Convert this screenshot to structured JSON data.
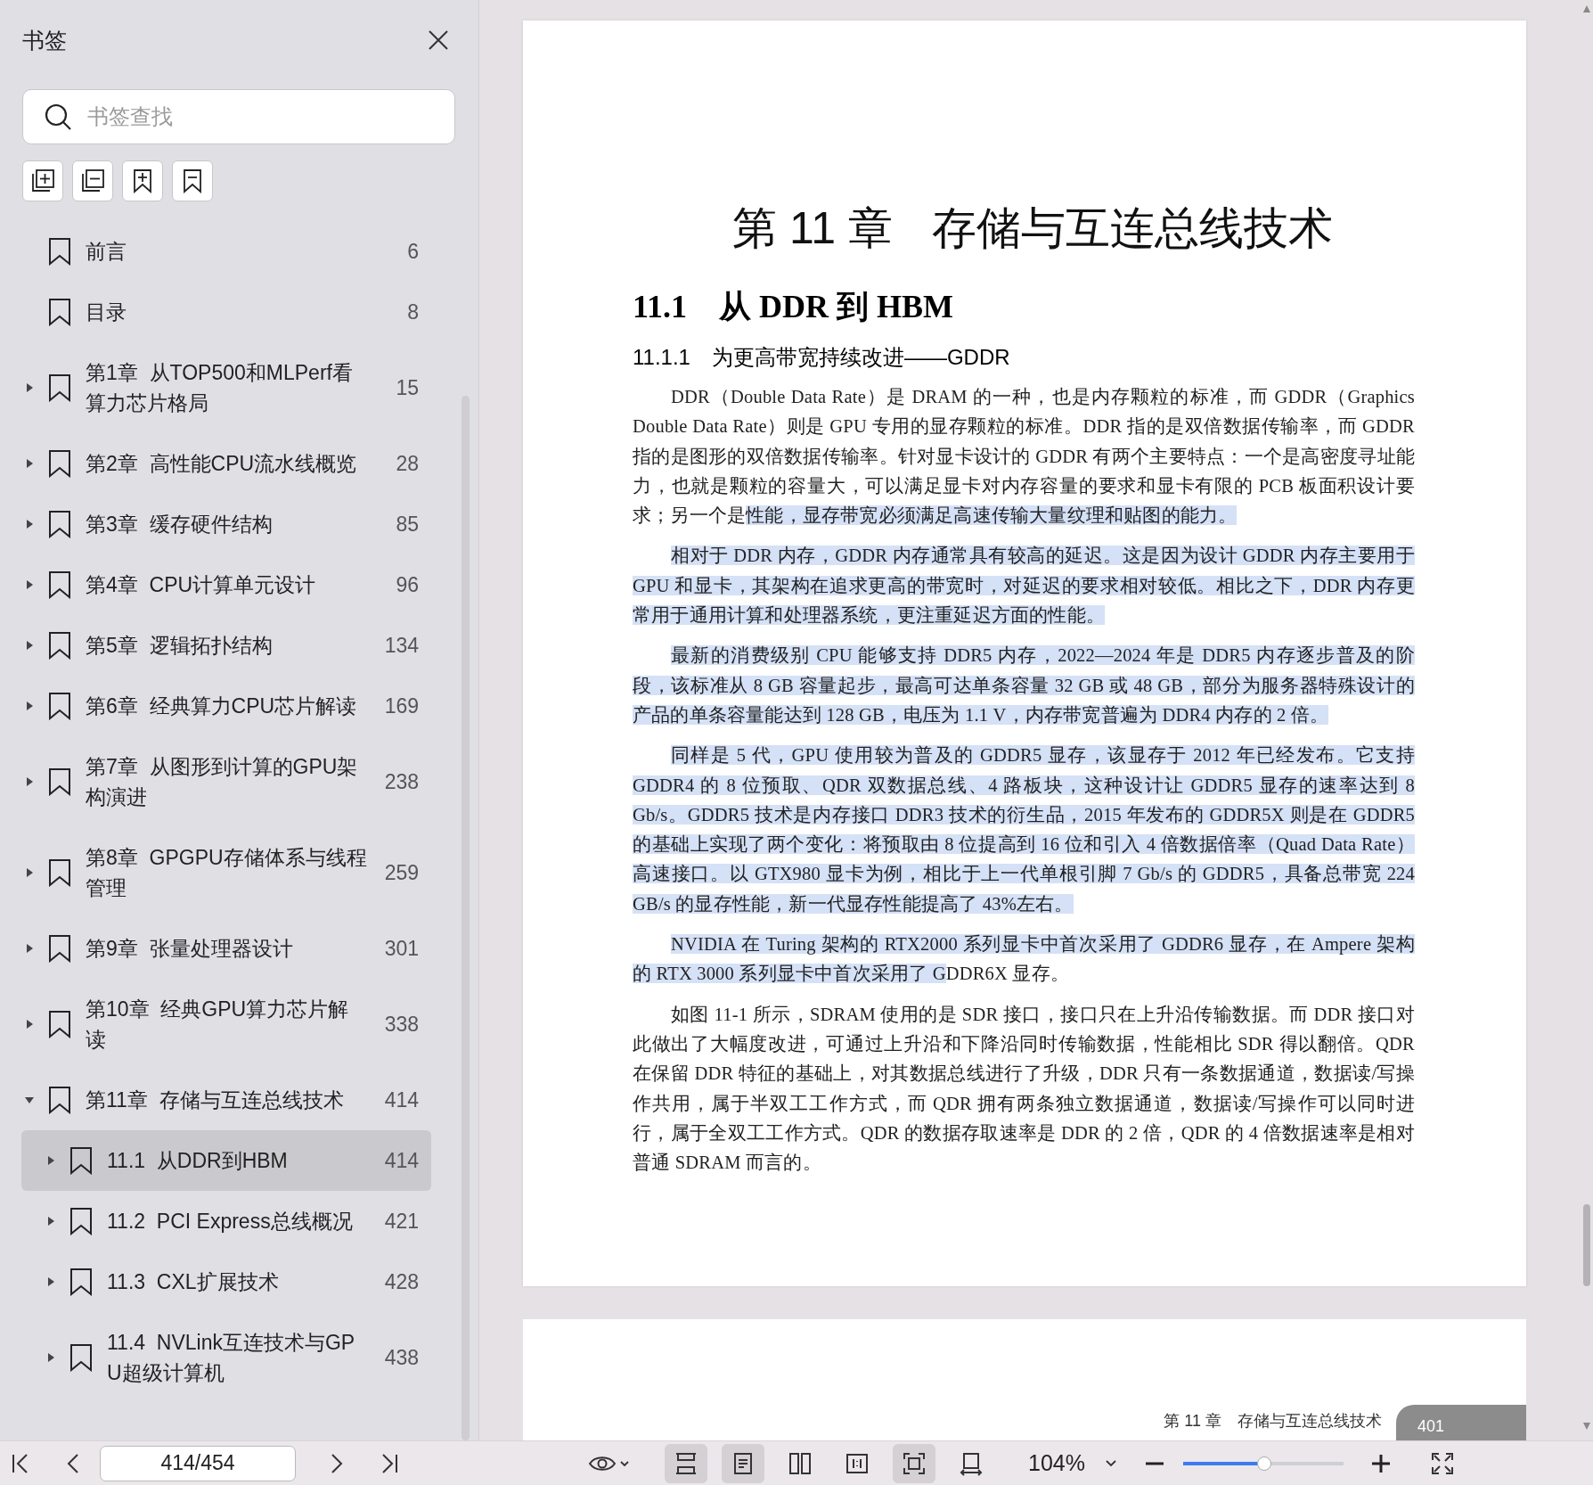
{
  "sidebar": {
    "title": "书签",
    "search": {
      "placeholder": "书签查找"
    },
    "tools": [
      {
        "kind": "expand-all"
      },
      {
        "kind": "collapse-all"
      },
      {
        "kind": "add"
      },
      {
        "kind": "remove"
      }
    ],
    "items": [
      {
        "label": "前言",
        "page": "6",
        "expandable": false,
        "selected": false
      },
      {
        "label": "目录",
        "page": "8",
        "expandable": false,
        "selected": false
      },
      {
        "label": "第1章  从TOP500和MLPerf看算力芯片格局",
        "page": "15",
        "expandable": true,
        "expanded": false,
        "selected": false
      },
      {
        "label": "第2章  高性能CPU流水线概览",
        "page": "28",
        "expandable": true,
        "expanded": false,
        "selected": false
      },
      {
        "label": "第3章  缓存硬件结构",
        "page": "85",
        "expandable": true,
        "expanded": false,
        "selected": false
      },
      {
        "label": "第4章  CPU计算单元设计",
        "page": "96",
        "expandable": true,
        "expanded": false,
        "selected": false
      },
      {
        "label": "第5章  逻辑拓扑结构",
        "page": "134",
        "expandable": true,
        "expanded": false,
        "selected": false
      },
      {
        "label": "第6章  经典算力CPU芯片解读",
        "page": "169",
        "expandable": true,
        "expanded": false,
        "selected": false
      },
      {
        "label": "第7章  从图形到计算的GPU架构演进",
        "page": "238",
        "expandable": true,
        "expanded": false,
        "selected": false
      },
      {
        "label": "第8章  GPGPU存储体系与线程管理",
        "page": "259",
        "expandable": true,
        "expanded": false,
        "selected": false
      },
      {
        "label": "第9章  张量处理器设计",
        "page": "301",
        "expandable": true,
        "expanded": false,
        "selected": false
      },
      {
        "label": "第10章  经典GPU算力芯片解读",
        "page": "338",
        "expandable": true,
        "expanded": false,
        "selected": false
      },
      {
        "label": "第11章  存储与互连总线技术",
        "page": "414",
        "expandable": true,
        "expanded": true,
        "selected": false,
        "children": [
          {
            "label": "11.1  从DDR到HBM",
            "page": "414",
            "expandable": true,
            "expanded": false,
            "selected": true
          },
          {
            "label": "11.2  PCI Express总线概况",
            "page": "421",
            "expandable": true,
            "expanded": false,
            "selected": false
          },
          {
            "label": "11.3  CXL扩展技术",
            "page": "428",
            "expandable": true,
            "expanded": false,
            "selected": false
          },
          {
            "label": "11.4  NVLink互连技术与GPU超级计算机",
            "page": "438",
            "expandable": true,
            "expanded": false,
            "selected": false
          }
        ]
      }
    ]
  },
  "page": {
    "chapter_number": "第 11 章",
    "chapter_title": "存储与互连总线技术",
    "section": "11.1　从 DDR 到 HBM",
    "subsection": "11.1.1　为更高带宽持续改进——GDDR",
    "paragraphs": [
      [
        {
          "text": "DDR（Double Data Rate）是 DRAM 的一种，也是内存颗粒的标准，而 GDDR（Graphics Double Data Rate）则是 GPU 专用的显存颗粒的标准。DDR 指的是双倍数据传输率，而 GDDR 指的是图形的双倍数据传输率。针对显卡设计的 GDDR 有两个主要特点：一个是高密度寻址能力，也就是颗粒的容量大，可以满足显卡对内存容量的要求和显卡有限的 PCB 板面积设计要求；另一个是",
          "highlighted": false
        },
        {
          "text": "性能，显存带宽必须满足高速传输大量纹理和贴图的能力。",
          "highlighted": true
        }
      ],
      [
        {
          "text": "相对于 DDR 内存，GDDR 内存通常具有较高的延迟。这是因为设计 GDDR 内存主要用于 GPU 和显卡，其架构在追求更高的带宽时，对延迟的要求相对较低。相比之下，DDR 内存更常用于通用计算和处理器系统，更注重延迟方面的性能。",
          "highlighted": true
        }
      ],
      [
        {
          "text": "最新的消费级别 CPU 能够支持 DDR5 内存，2022—2024 年是 DDR5 内存逐步普及的阶段，该标准从 8 GB 容量起步，最高可达单条容量 32 GB 或 48 GB，部分为服务器特殊设计的产品的单条容量能达到 128 GB，电压为 1.1 V，内存带宽普遍为 DDR4 内存的 2 倍。",
          "highlighted": true
        }
      ],
      [
        {
          "text": "同样是 5 代，GPU 使用较为普及的 GDDR5 显存，该显存于 2012 年已经发布。它支持 GDDR4 的 8 位预取、QDR 双数据总线、4 路板块，这种设计让 GDDR5 显存的速率达到 8 Gb/s。GDDR5 技术是内存接口 DDR3 技术的衍生品，2015 年发布的 GDDR5X 则是在 GDDR5 的基础上实现了两个变化：将预取由 8 位提高到 16 位和引入 4 倍数据倍率（Quad Data Rate）高速接口。以 GTX980 显卡为例，相比于上一代单根引脚 7 Gb/s 的 GDDR5，具备总带宽 224 GB/s 的显存性能，新一代显存性能提高了 43%左右。",
          "highlighted": true
        }
      ],
      [
        {
          "text": "NVIDIA 在 Turing 架构的 RTX2000 系列显卡中首次采用了 GDDR6 显存，在 Ampere 架构的 RTX 3000 系列显卡中首次采用了 G",
          "highlighted": true
        },
        {
          "text": "DDR6X 显存。",
          "highlighted": false
        }
      ],
      [
        {
          "text": "如图 11-1 所示，SDRAM 使用的是 SDR 接口，接口只在上升沿传输数据。而 DDR 接口对此做出了大幅度改进，可通过上升沿和下降沿同时传输数据，性能相比 SDR 得以翻倍。QDR 在保留 DDR 特征的基础上，对其数据总线进行了升级，DDR 只有一条数据通道，数据读/写操作共用，属于半双工工作方式，而 QDR 拥有两条独立数据通道，数据读/写操作可以同时进行，属于全双工工作方式。QDR 的数据存取速率是 DDR 的 2 倍，QDR 的 4 倍数据速率是相对普通 SDRAM 而言的。",
          "highlighted": false
        }
      ]
    ]
  },
  "next_page": {
    "footer_title": "第 11 章　存储与互连总线技术",
    "page_number": "401"
  },
  "toolbar": {
    "page_field": "414/454",
    "zoom": "104%",
    "zoom_slider": {
      "level": 0.5
    },
    "view_tools": [
      {
        "kind": "continuous",
        "selected": true
      },
      {
        "kind": "single",
        "selected": true
      },
      {
        "kind": "double",
        "selected": false
      },
      {
        "kind": "actual",
        "selected": false
      },
      {
        "kind": "fit",
        "selected": true
      },
      {
        "kind": "rotate",
        "selected": false
      }
    ]
  }
}
